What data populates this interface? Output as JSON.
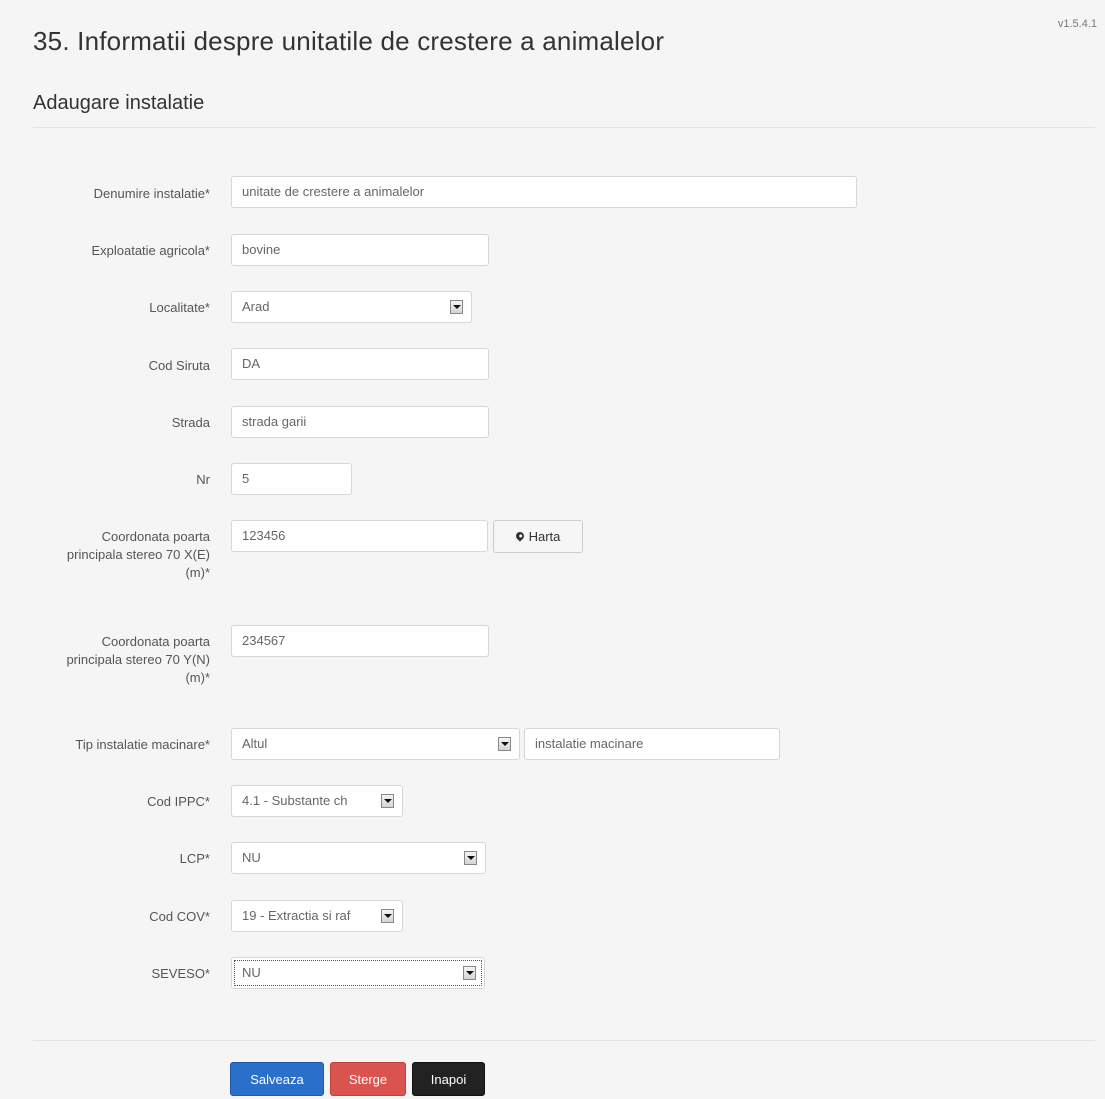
{
  "version": "v1.5.4.1",
  "page_title": "35. Informatii despre unitatile de crestere a animalelor",
  "section_title": "Adaugare instalatie",
  "fields": {
    "denumire": {
      "label": "Denumire instalatie*",
      "value": "unitate de crestere a animalelor"
    },
    "exploatatie": {
      "label": "Exploatatie agricola*",
      "value": "bovine"
    },
    "localitate": {
      "label": "Localitate*",
      "value": "Arad"
    },
    "cod_siruta": {
      "label": "Cod Siruta",
      "value": "DA"
    },
    "strada": {
      "label": "Strada",
      "value": "strada garii"
    },
    "nr": {
      "label": "Nr",
      "value": "5"
    },
    "coord_x": {
      "label_line1": "Coordonata poarta",
      "label_line2": "principala stereo 70 X(E)",
      "label_line3": "(m)*",
      "value": "123456"
    },
    "coord_y": {
      "label_line1": "Coordonata poarta",
      "label_line2": "principala stereo 70 Y(N)",
      "label_line3": "(m)*",
      "value": "234567"
    },
    "tip_instalatie": {
      "label": "Tip instalatie macinare*",
      "value": "Altul",
      "other_value": "instalatie macinare"
    },
    "cod_ippc": {
      "label": "Cod IPPC*",
      "value": "4.1 - Substante ch"
    },
    "lcp": {
      "label": "LCP*",
      "value": "NU"
    },
    "cod_cov": {
      "label": "Cod COV*",
      "value": "19 - Extractia si raf"
    },
    "seveso": {
      "label": "SEVESO*",
      "value": "NU"
    }
  },
  "map_button": {
    "label": "Harta",
    "icon": "map-marker-icon"
  },
  "actions": {
    "save": "Salveaza",
    "delete": "Sterge",
    "back": "Inapoi"
  },
  "colors": {
    "save": "#2a6fc9",
    "delete": "#d9534f",
    "back": "#222222"
  }
}
